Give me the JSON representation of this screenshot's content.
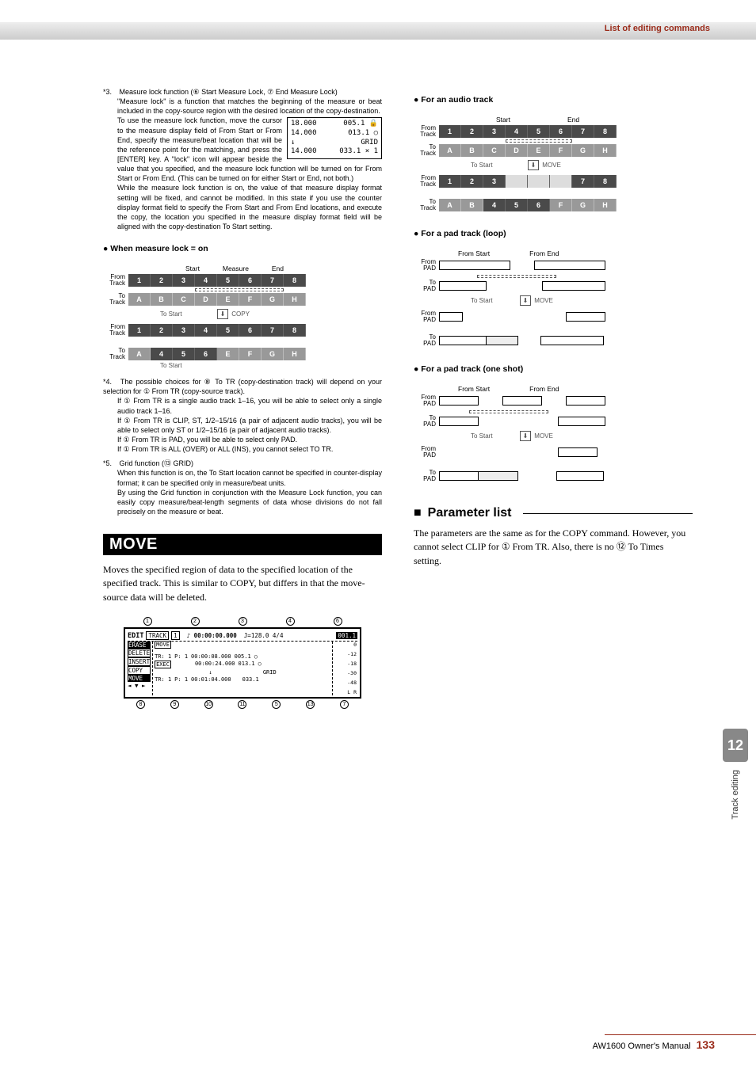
{
  "header": {
    "section_title": "List of editing commands"
  },
  "footnotes": {
    "n3_label": "*3.",
    "n3_a": "Measure lock function (⑥ Start Measure Lock, ⑦ End Measure Lock)",
    "n3_b": "\"Measure lock\" is a function that matches the beginning of the measure or beat included in the copy-source region with the desired location of the copy-destination.",
    "n3_c": "To use the measure lock function, move the cursor to the measure display field of From Start or From End, specify the measure/beat location that will be the reference point for the matching, and press the [ENTER] key. A \"lock\" icon will appear beside the value that you specified, and the measure lock function will be turned on for From Start or From End. (This can be turned on for either Start or End, not both.)",
    "n3_d": "While the measure lock function is on, the value of that measure display format setting will be fixed, and cannot be modified. In this state if you use the counter display format field to specify the From Start and From End locations, and execute the copy, the location you specified in the measure display format field will be aligned with the copy-destination To Start setting.",
    "n4_label": "*4.",
    "n4_a": "The possible choices for ⑧ To TR (copy-destination track) will depend on your selection for ① From TR (copy-source track).",
    "n4_b": "If ① From TR is a single audio track 1–16, you will be able to select only a single audio track 1–16.",
    "n4_c": "If ① From TR is CLIP, ST, 1/2–15/16 (a pair of adjacent audio tracks), you will be able to select only ST or 1/2–15/16 (a pair of adjacent audio tracks).",
    "n4_d": "If ① From TR is PAD, you will be able to select only PAD.",
    "n4_e": "If ① From TR is ALL (OVER) or ALL (INS), you cannot select TO TR.",
    "n5_label": "*5.",
    "n5_a": "Grid function (⑬ GRID)",
    "n5_b": "When this function is on, the To Start location cannot be specified in counter-display format; it can be specified only in measure/beat units.",
    "n5_c": "By using the Grid function in conjunction with the Measure Lock function, you can easily copy measure/beat-length segments of data whose divisions do not fall precisely on the measure or beat."
  },
  "lcd": {
    "l1_left": "18.000",
    "l1_right": "005.1 🔒",
    "l2_left": "14.000",
    "l2_right": "013.1 ○",
    "l3_left": "↓",
    "l3_right": "GRID",
    "l4_left": "14.000",
    "l4_right": "033.1 × 1"
  },
  "sub_headings": {
    "measure_lock_on": "When measure lock = on",
    "audio_track": "For an audio track",
    "pad_loop": "For a pad track (loop)",
    "pad_oneshot": "For a pad track (one shot)"
  },
  "diagram_labels": {
    "measure": "Measure",
    "start": "Start",
    "end": "End",
    "from_track": "From\nTrack",
    "to_track": "To\nTrack",
    "from_pad": "From\nPAD",
    "to_pad": "To\nPAD",
    "to_start": "To Start",
    "from_start": "From Start",
    "from_end": "From End",
    "copy": "COPY",
    "move": "MOVE",
    "nums": [
      "1",
      "2",
      "3",
      "4",
      "5",
      "6",
      "7",
      "8"
    ],
    "letters": [
      "A",
      "B",
      "C",
      "D",
      "E",
      "F",
      "G",
      "H"
    ],
    "copy_result": [
      "A",
      "4",
      "5",
      "6",
      "E",
      "F",
      "G",
      "H"
    ],
    "move_from_result": [
      "1",
      "2",
      "3",
      "",
      "",
      "",
      "7",
      "8"
    ],
    "move_to_result": [
      "A",
      "B",
      "4",
      "5",
      "6",
      "F",
      "G",
      "H"
    ]
  },
  "move": {
    "heading": "MOVE",
    "desc": "Moves the specified region of data to the specified location of the specified track. This is similar to COPY, but differs in that the move-source data will be deleted."
  },
  "screen": {
    "top_callouts": [
      "1",
      "2",
      "3",
      "4",
      "6"
    ],
    "bot_callouts": [
      "8",
      "9",
      "10",
      "11",
      "5",
      "13",
      "7"
    ],
    "title": "EDIT",
    "menu": [
      "ERASE",
      "DELETE",
      "INSERT",
      "COPY",
      "MOVE"
    ],
    "track_label": "TRACK",
    "btn_move": "MOVE",
    "btn_exec": "EXEC",
    "tr1": "TR: 1",
    "p1": "P: 1",
    "v1": "00:00:00.000",
    "tempo": "J=128.0 4/4",
    "bar": "001.1",
    "from": "00:00:08.000",
    "to": "00:00:24.000",
    "loc1": "005.1",
    "loc2": "013.1",
    "grid": "GRID",
    "tr2": "TR: 1",
    "p2": "P: 1",
    "toStart": "00:01:04.000",
    "loc3": "033.1",
    "meter_vals": [
      "0",
      "-12",
      "-18",
      "-30",
      "-48"
    ],
    "lr": "L R"
  },
  "parameter": {
    "heading": "Parameter list",
    "body": "The parameters are the same as for the COPY command. However, you cannot select CLIP for ① From TR. Also, there is no ⑫ To Times setting."
  },
  "side_tab": {
    "num": "12",
    "label": "Track editing"
  },
  "footer": {
    "text": "AW1600  Owner's Manual",
    "page": "133"
  }
}
